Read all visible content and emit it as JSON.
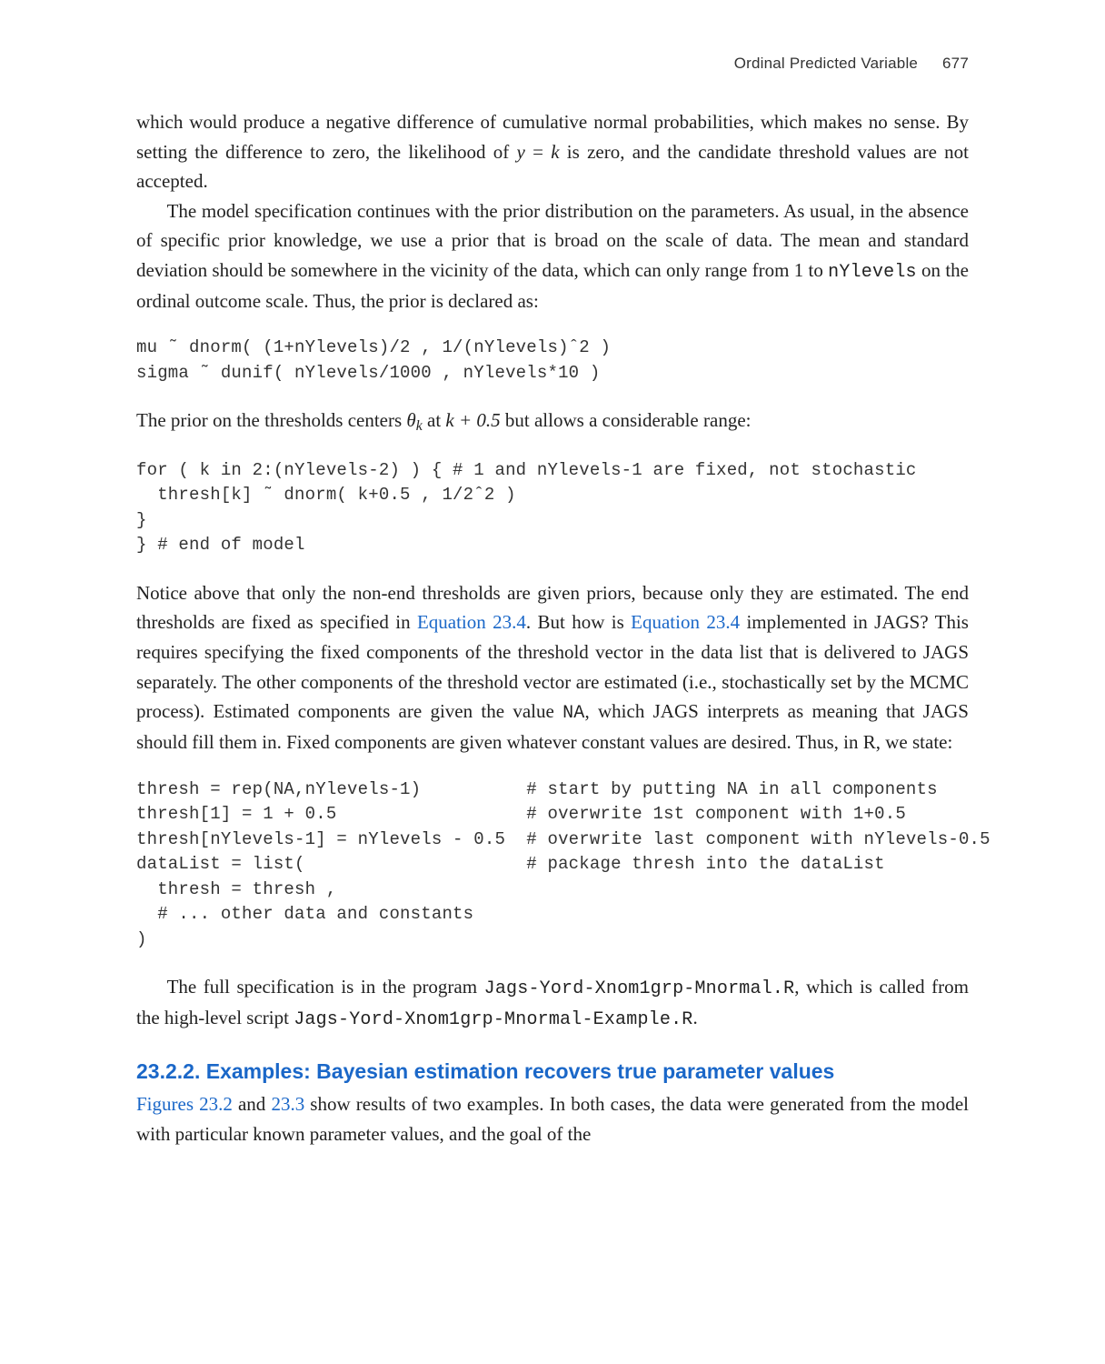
{
  "header": {
    "running_title": "Ordinal Predicted Variable",
    "page_number": "677"
  },
  "para": {
    "p1": "which would produce a negative difference of cumulative normal probabilities, which makes no sense. By setting the difference to zero, the likelihood of ",
    "p1b": " is zero, and the candidate threshold values are not accepted.",
    "p1_eq_lhs": "y",
    "p1_eq_eq": " = ",
    "p1_eq_rhs": "k",
    "p2a": "The model specification continues with the prior distribution on the parameters. As usual, in the absence of specific prior knowledge, we use a prior that is broad on the scale of data. The mean and standard deviation should be somewhere in the vicinity of the data, which can only range from 1 to ",
    "p2code": "nYlevels",
    "p2b": " on the ordinal outcome scale. Thus, the prior is declared as:",
    "p3a": "The prior on the thresholds centers ",
    "p3theta": "θ",
    "p3sub": "k",
    "p3b": " at ",
    "p3expr": "k + 0.5",
    "p3c": " but allows a considerable range:",
    "p4a": "Notice above that only the non-end thresholds are given priors, because only they are estimated. The end thresholds are fixed as specified in ",
    "p4link1": "Equation 23.4",
    "p4b": ". But how is ",
    "p4link2": "Equation 23.4",
    "p4c": " implemented in JAGS? This requires specifying the fixed components of the threshold vector in the data list that is delivered to JAGS separately. The other components of the threshold vector are estimated (i.e., stochastically set by the MCMC process). Estimated components are given the value ",
    "p4code": "NA",
    "p4d": ", which JAGS interprets as meaning that JAGS should fill them in. Fixed components are given whatever constant values are desired. Thus, in R, we state:",
    "p5a": "The full specification is in the program ",
    "p5code1": "Jags-Yord-Xnom1grp-Mnormal.R",
    "p5b": ", which is called from the high-level script ",
    "p5code2": "Jags-Yord-Xnom1grp-Mnormal-Example.R",
    "p5c": ".",
    "p6a": " and ",
    "p6link1": "Figures 23.2",
    "p6link2": "23.3",
    "p6b": " show results of two examples. In both cases, the data were generated from the model with particular known parameter values, and the goal of the"
  },
  "code": {
    "block1": "mu ˜ dnorm( (1+nYlevels)/2 , 1/(nYlevels)ˆ2 )\nsigma ˜ dunif( nYlevels/1000 , nYlevels*10 )",
    "block2": "for ( k in 2:(nYlevels-2) ) { # 1 and nYlevels-1 are fixed, not stochastic\n  thresh[k] ˜ dnorm( k+0.5 , 1/2ˆ2 )\n}\n} # end of model",
    "block3": "thresh = rep(NA,nYlevels-1)          # start by putting NA in all components\nthresh[1] = 1 + 0.5                  # overwrite 1st component with 1+0.5\nthresh[nYlevels-1] = nYlevels - 0.5  # overwrite last component with nYlevels-0.5\ndataList = list(                     # package thresh into the dataList\n  thresh = thresh ,\n  # ... other data and constants\n)"
  },
  "section": {
    "num": "23.2.2.",
    "title": " Examples: Bayesian estimation recovers true parameter values"
  }
}
